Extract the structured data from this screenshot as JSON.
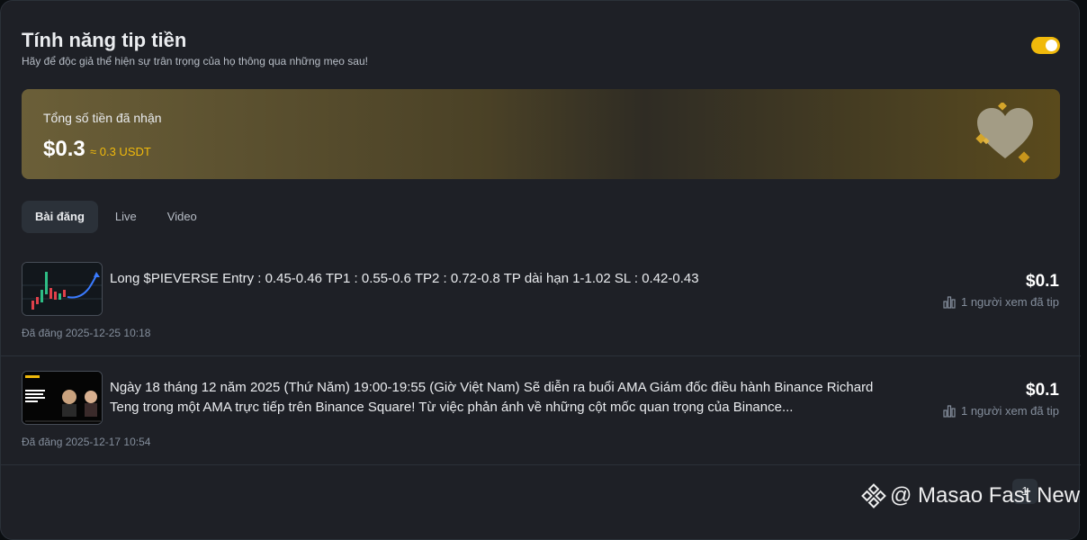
{
  "header": {
    "title": "Tính năng tip tiền",
    "subtitle": "Hãy để độc giả thể hiện sự trân trọng của họ thông qua những mẹo sau!"
  },
  "summary": {
    "label": "Tổng số tiền đã nhận",
    "amount": "$0.3",
    "usdt": "≈ 0.3 USDT"
  },
  "tabs": [
    {
      "label": "Bài đăng"
    },
    {
      "label": "Live"
    },
    {
      "label": "Video"
    }
  ],
  "posts": [
    {
      "text": "Long $PIEVERSE Entry : 0.45-0.46 TP1 : 0.55-0.6 TP2 : 0.72-0.8 TP dài hạn 1-1.02 SL : 0.42-0.43",
      "price": "$0.1",
      "viewers": "1 người xem đã tip",
      "posted": "Đã đăng 2025-12-25 10:18"
    },
    {
      "text": "Ngày 18 tháng 12 năm 2025 (Thứ Năm) 19:00-19:55 (Giờ Việt Nam) Sẽ diễn ra buổi AMA Giám đốc điều hành Binance Richard Teng trong một AMA trực tiếp trên Binance Square! Từ việc phản ánh về những cột mốc quan trọng của Binance...",
      "price": "$0.1",
      "viewers": "1 người xem đã tip",
      "posted": "Đã đăng 2025-12-17 10:54"
    }
  ],
  "pagination": {
    "page": "1"
  },
  "watermark": {
    "text": "@ Masao Fast New"
  },
  "colors": {
    "accent": "#f0b90b",
    "panel": "#1e2026",
    "background": "#0b0e11"
  }
}
